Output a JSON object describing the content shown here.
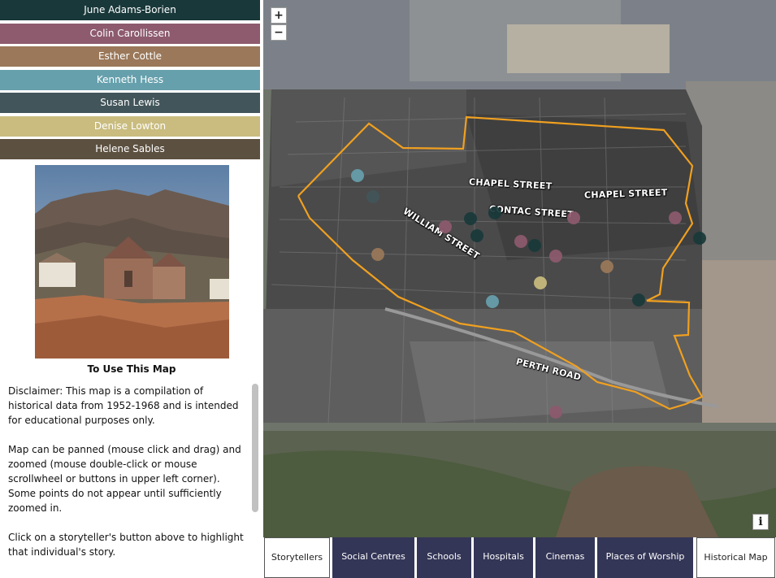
{
  "storytellers": [
    {
      "name": "June Adams-Borien",
      "color": "#19383a"
    },
    {
      "name": "Colin Carollissen",
      "color": "#8d5a6e"
    },
    {
      "name": "Esther Cottle",
      "color": "#9a7859"
    },
    {
      "name": "Kenneth Hess",
      "color": "#66a0ac"
    },
    {
      "name": "Susan Lewis",
      "color": "#42555a"
    },
    {
      "name": "Denise Lowton",
      "color": "#c9bc7e"
    },
    {
      "name": "Helene Sables",
      "color": "#5c5040"
    }
  ],
  "intro": {
    "title": "To Use This Map",
    "paragraphs": [
      "Disclaimer: This map is a compilation of historical data from 1952-1968 and is intended for educational purposes only.",
      "Map can be panned (mouse click and drag) and zoomed (mouse double-click or mouse scrollwheel or buttons in upper left corner). Some points do not appear until sufficiently zoomed in.",
      "Click on a storyteller's button above to highlight that individual's story."
    ]
  },
  "map": {
    "zoom_in": "+",
    "zoom_out": "−",
    "info": "i",
    "streets": [
      "CHAPEL STREET",
      "CHAPEL STREET",
      "CONTAC STREET",
      "WILLIAM STREET",
      "PERTH ROAD"
    ],
    "boundary_color": "#f0a020"
  },
  "tabs": [
    {
      "label": "Storytellers",
      "style": "light"
    },
    {
      "label": "Social Centres",
      "style": "dark"
    },
    {
      "label": "Schools",
      "style": "dark"
    },
    {
      "label": "Hospitals",
      "style": "dark"
    },
    {
      "label": "Cinemas",
      "style": "dark"
    },
    {
      "label": "Places of Worship",
      "style": "dark"
    },
    {
      "label": "Historical Map",
      "style": "light"
    }
  ]
}
